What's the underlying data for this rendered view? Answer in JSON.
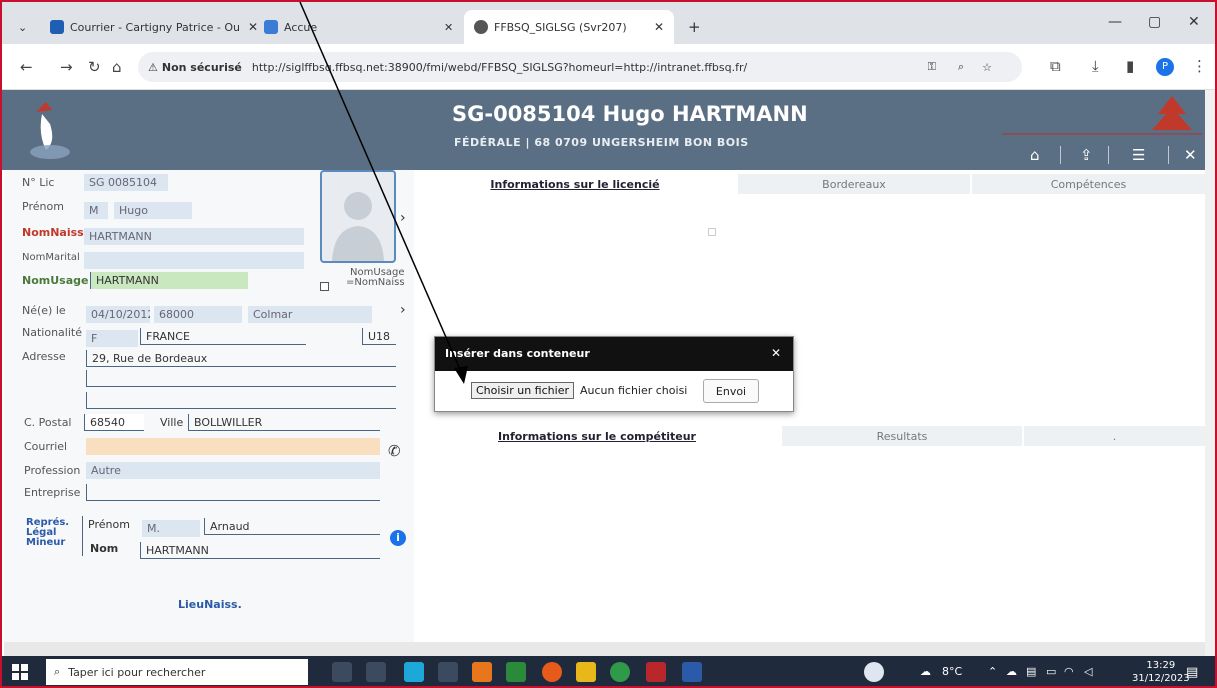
{
  "browser": {
    "tabs": [
      {
        "label": "Courrier - Cartigny Patrice - Ou",
        "favicon_color": "#1e5fb4"
      },
      {
        "label": "Accue",
        "favicon_color": "#3a7bd5"
      },
      {
        "label": "FFBSQ_SIGLSG (Svr207)",
        "favicon_color": "#555555"
      }
    ],
    "tab_close": "✕",
    "new_tab": "+",
    "security_label": "Non sécurisé",
    "url": "http://siglffbsq.ffbsq.net:38900/fmi/webd/FFBSQ_SIGLSG?homeurl=http://intranet.ffbsq.fr/",
    "profile_initial": "P"
  },
  "header": {
    "title": "SG-0085104 Hugo HARTMANN",
    "subtitle": "FÉDÉRALE | 68 0709 UNGERSHEIM BON BOIS",
    "accent": "#5a6f84"
  },
  "form": {
    "labels": {
      "lic": "N° Lic",
      "prenom": "Prénom",
      "nomnaiss": "NomNaiss",
      "nommarital": "NomMarital",
      "nomusage": "NomUsage",
      "ne_le": "Né(e) le",
      "nationalite": "Nationalité",
      "adresse": "Adresse",
      "cpostal": "C. Postal",
      "ville": "Ville",
      "courriel": "Courriel",
      "profession": "Profession",
      "entreprise": "Entreprise",
      "repres": "Représ.",
      "legal": "Légal",
      "mineur": "Mineur",
      "rep_prenom": "Prénom",
      "rep_nom": "Nom",
      "nomusage_chk_1": "NomUsage",
      "nomusage_chk_2": "=NomNaiss",
      "lieunaiss": "LieuNaiss."
    },
    "values": {
      "lic": "SG 0085104",
      "civ": "M",
      "prenom": "Hugo",
      "nomnaiss": "HARTMANN",
      "nommarital": "",
      "nomusage": "HARTMANN",
      "ne_le": "04/10/2012",
      "cp_naiss": "68000",
      "ville_naiss": "Colmar",
      "nat_code": "F",
      "nationalite": "FRANCE",
      "categorie": "U18",
      "adresse1": "29, Rue de Bordeaux",
      "adresse2": "",
      "adresse3": "",
      "cpostal": "68540",
      "ville": "BOLLWILLER",
      "courriel": "",
      "profession": "Autre",
      "entreprise": "",
      "rep_civ": "M.",
      "rep_prenom": "Arnaud",
      "rep_nom": "HARTMANN"
    }
  },
  "right": {
    "tabs_top": [
      "Informations sur le licencié",
      "Bordereaux",
      "Compétences"
    ],
    "tabs_bottom": [
      "Informations sur le compétiteur",
      "Resultats",
      "."
    ]
  },
  "dialog": {
    "title": "Insérer dans conteneur",
    "choose_label": "Choisir un fichier",
    "no_file": "Aucun fichier choisi",
    "send_label": "Envoi",
    "close": "✕"
  },
  "taskbar": {
    "search_placeholder": "Taper ici pour rechercher",
    "temperature": "8°C",
    "time": "13:29",
    "date": "31/12/2023"
  }
}
